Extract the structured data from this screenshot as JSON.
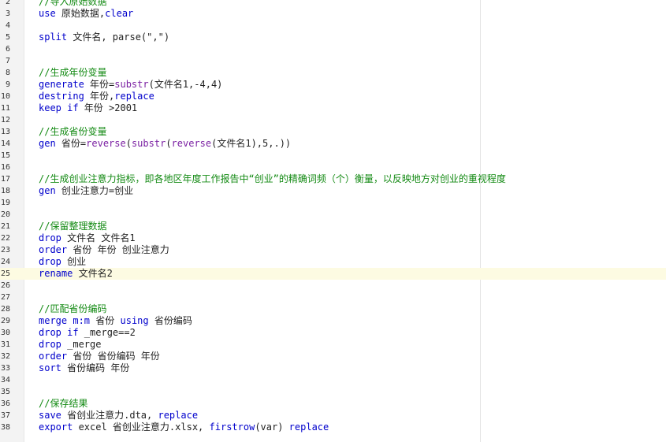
{
  "editor": {
    "current_line": 25,
    "lines": [
      {
        "n": "2",
        "tokens": [
          {
            "c": "cm",
            "t": "//导入原始数据"
          }
        ]
      },
      {
        "n": "3",
        "tokens": [
          {
            "c": "kw",
            "t": "use"
          },
          {
            "c": "txt",
            "t": " 原始数据,"
          },
          {
            "c": "kw",
            "t": "clear"
          }
        ]
      },
      {
        "n": "4",
        "tokens": []
      },
      {
        "n": "5",
        "tokens": [
          {
            "c": "kw",
            "t": "split"
          },
          {
            "c": "txt",
            "t": " 文件名, parse(\",\")"
          }
        ]
      },
      {
        "n": "6",
        "tokens": []
      },
      {
        "n": "7",
        "tokens": []
      },
      {
        "n": "8",
        "tokens": [
          {
            "c": "cm",
            "t": "//生成年份变量"
          }
        ]
      },
      {
        "n": "9",
        "tokens": [
          {
            "c": "kw",
            "t": "generate"
          },
          {
            "c": "txt",
            "t": " 年份="
          },
          {
            "c": "fn",
            "t": "substr"
          },
          {
            "c": "txt",
            "t": "(文件名1,-4,4)"
          }
        ]
      },
      {
        "n": "10",
        "tokens": [
          {
            "c": "kw",
            "t": "destring"
          },
          {
            "c": "txt",
            "t": " 年份,"
          },
          {
            "c": "kw",
            "t": "replace"
          }
        ]
      },
      {
        "n": "11",
        "tokens": [
          {
            "c": "kw",
            "t": "keep if"
          },
          {
            "c": "txt",
            "t": " 年份 >2001"
          }
        ]
      },
      {
        "n": "12",
        "tokens": []
      },
      {
        "n": "13",
        "tokens": [
          {
            "c": "cm",
            "t": "//生成省份变量"
          }
        ]
      },
      {
        "n": "14",
        "tokens": [
          {
            "c": "kw",
            "t": "gen"
          },
          {
            "c": "txt",
            "t": " 省份="
          },
          {
            "c": "fn",
            "t": "reverse"
          },
          {
            "c": "txt",
            "t": "("
          },
          {
            "c": "fn",
            "t": "substr"
          },
          {
            "c": "txt",
            "t": "("
          },
          {
            "c": "fn",
            "t": "reverse"
          },
          {
            "c": "txt",
            "t": "(文件名1),5,.))"
          }
        ]
      },
      {
        "n": "15",
        "tokens": []
      },
      {
        "n": "16",
        "tokens": []
      },
      {
        "n": "17",
        "tokens": [
          {
            "c": "cm",
            "t": "//生成创业注意力指标，即各地区年度工作报告中“创业”的精确词频（个）衡量，以反映地方对创业的重视程度"
          }
        ]
      },
      {
        "n": "18",
        "tokens": [
          {
            "c": "kw",
            "t": "gen"
          },
          {
            "c": "txt",
            "t": " 创业注意力=创业"
          }
        ]
      },
      {
        "n": "19",
        "tokens": []
      },
      {
        "n": "20",
        "tokens": []
      },
      {
        "n": "21",
        "tokens": [
          {
            "c": "cm",
            "t": "//保留整理数据"
          }
        ]
      },
      {
        "n": "22",
        "tokens": [
          {
            "c": "kw",
            "t": "drop"
          },
          {
            "c": "txt",
            "t": " 文件名 文件名1"
          }
        ]
      },
      {
        "n": "23",
        "tokens": [
          {
            "c": "kw",
            "t": "order"
          },
          {
            "c": "txt",
            "t": " 省份 年份 创业注意力"
          }
        ]
      },
      {
        "n": "24",
        "tokens": [
          {
            "c": "kw",
            "t": "drop"
          },
          {
            "c": "txt",
            "t": " 创业"
          }
        ]
      },
      {
        "n": "25",
        "tokens": [
          {
            "c": "kw",
            "t": "rename"
          },
          {
            "c": "txt",
            "t": " 文件名2"
          }
        ]
      },
      {
        "n": "26",
        "tokens": []
      },
      {
        "n": "27",
        "tokens": []
      },
      {
        "n": "28",
        "tokens": [
          {
            "c": "cm",
            "t": "//匹配省份编码"
          }
        ]
      },
      {
        "n": "29",
        "tokens": [
          {
            "c": "kw",
            "t": "merge"
          },
          {
            "c": "txt",
            "t": " "
          },
          {
            "c": "kw",
            "t": "m:m"
          },
          {
            "c": "txt",
            "t": " 省份 "
          },
          {
            "c": "kw",
            "t": "using"
          },
          {
            "c": "txt",
            "t": " 省份编码"
          }
        ]
      },
      {
        "n": "30",
        "tokens": [
          {
            "c": "kw",
            "t": "drop if"
          },
          {
            "c": "txt",
            "t": " _merge==2"
          }
        ]
      },
      {
        "n": "31",
        "tokens": [
          {
            "c": "kw",
            "t": "drop"
          },
          {
            "c": "txt",
            "t": " _merge"
          }
        ]
      },
      {
        "n": "32",
        "tokens": [
          {
            "c": "kw",
            "t": "order"
          },
          {
            "c": "txt",
            "t": " 省份 省份编码 年份"
          }
        ]
      },
      {
        "n": "33",
        "tokens": [
          {
            "c": "kw",
            "t": "sort"
          },
          {
            "c": "txt",
            "t": " 省份编码 年份"
          }
        ]
      },
      {
        "n": "34",
        "tokens": []
      },
      {
        "n": "35",
        "tokens": []
      },
      {
        "n": "36",
        "tokens": [
          {
            "c": "cm",
            "t": "//保存结果"
          }
        ]
      },
      {
        "n": "37",
        "tokens": [
          {
            "c": "kw",
            "t": "save"
          },
          {
            "c": "txt",
            "t": " 省创业注意力.dta, "
          },
          {
            "c": "kw",
            "t": "replace"
          }
        ]
      },
      {
        "n": "38",
        "tokens": [
          {
            "c": "kw",
            "t": "export"
          },
          {
            "c": "txt",
            "t": " excel 省创业注意力.xlsx, "
          },
          {
            "c": "kw",
            "t": "firstrow"
          },
          {
            "c": "txt",
            "t": "(var) "
          },
          {
            "c": "kw",
            "t": "replace"
          }
        ]
      }
    ]
  }
}
